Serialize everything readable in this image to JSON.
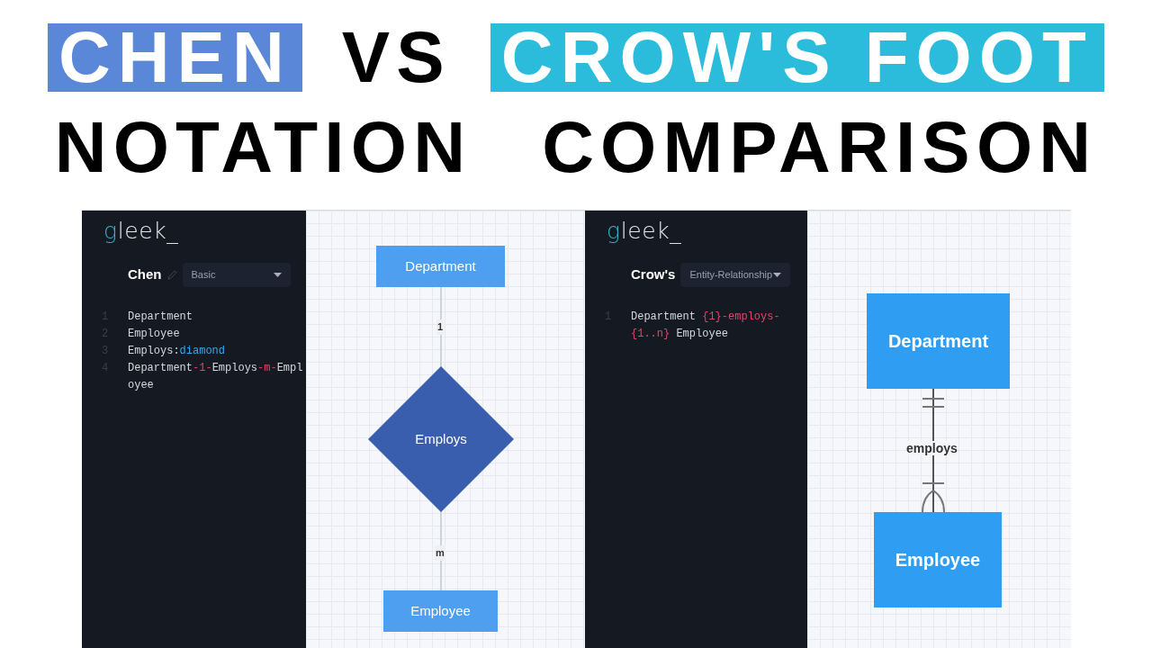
{
  "headline": [
    [
      {
        "text": "CHEN",
        "color": "#5b87d9"
      },
      {
        "text": "VS"
      },
      {
        "text": "CROW'S FOOT",
        "color": "#2bbcdc"
      }
    ],
    [
      {
        "text": "NOTATION"
      },
      {
        "text": "COMPARISON"
      }
    ]
  ],
  "panels": [
    {
      "logo": "gleek_",
      "diagram_name": "Chen",
      "edit_icon": true,
      "notation": "Basic",
      "code_rows": [
        {
          "number": "1",
          "tokens": [
            {
              "text": "Department",
              "kind": "plain"
            }
          ]
        },
        {
          "number": "2",
          "tokens": [
            {
              "text": "Employee",
              "kind": "plain"
            }
          ]
        },
        {
          "number": "3",
          "tokens": [
            {
              "text": "Employs:",
              "kind": "plain"
            },
            {
              "text": "diamond",
              "kind": "shape"
            }
          ]
        },
        {
          "number": "4",
          "tokens": [
            {
              "text": "Department",
              "kind": "plain"
            },
            {
              "text": "-1-",
              "kind": "cardinality"
            },
            {
              "text": "Employs",
              "kind": "plain"
            },
            {
              "text": "-m-",
              "kind": "cardinality"
            },
            {
              "text": "Empl",
              "kind": "plain"
            }
          ]
        },
        {
          "tokens": [
            {
              "text": "oyee",
              "kind": "plain"
            }
          ]
        }
      ],
      "diagram": {
        "kind": "chen",
        "top": "Department",
        "middle": "Employs",
        "bottom": "Employee",
        "top_label": "1",
        "bottom_label": "m"
      }
    },
    {
      "logo": "gleek_",
      "diagram_name": "Crow's",
      "edit_icon": false,
      "notation": "Entity-Relationship",
      "code_rows": [
        {
          "number": "1",
          "tokens": [
            {
              "text": "Department ",
              "kind": "plain"
            },
            {
              "text": "{1}-employs-",
              "kind": "cardinality"
            }
          ]
        },
        {
          "tokens": [
            {
              "text": "{1..n}",
              "kind": "cardinality"
            },
            {
              "text": " Employee",
              "kind": "plain"
            }
          ]
        }
      ],
      "diagram": {
        "kind": "crows_foot",
        "top": "Department",
        "bottom": "Employee",
        "label": "employs",
        "ends": [
          {
            "kind": "one_and_only_one"
          },
          {
            "kind": "one_or_many"
          }
        ]
      }
    }
  ]
}
